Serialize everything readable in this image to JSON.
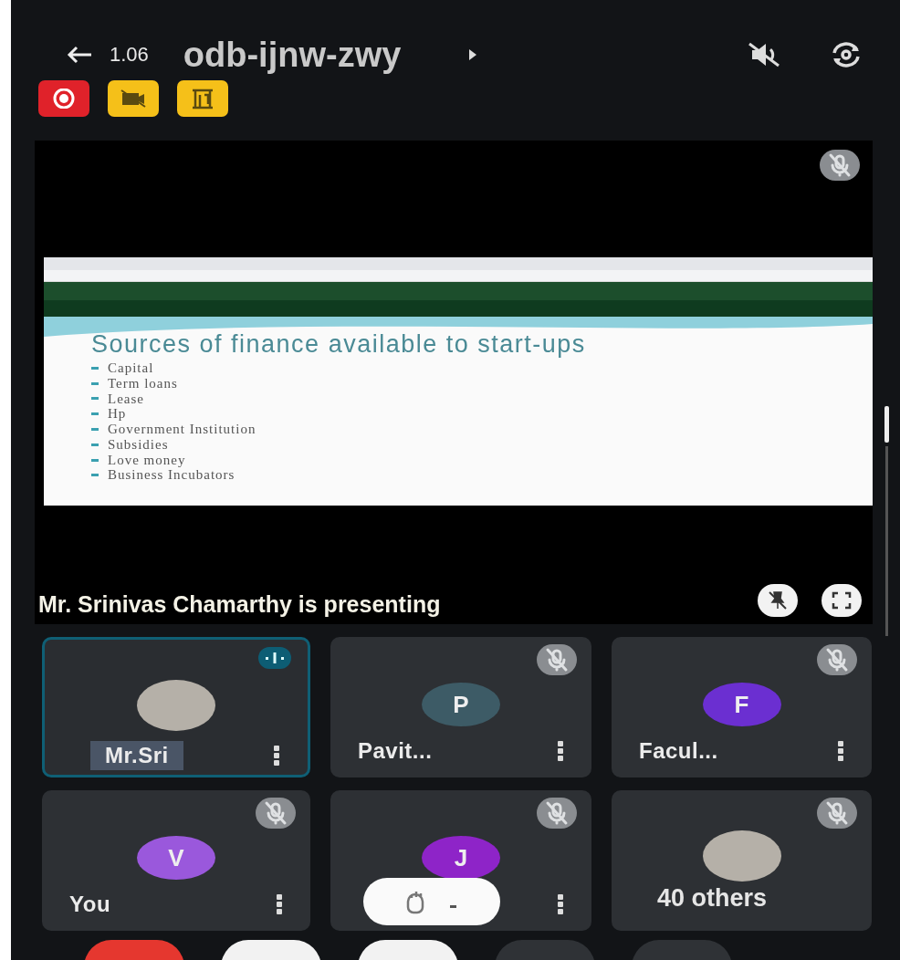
{
  "top_bar": {
    "speed": "1.06",
    "meeting_code": "odb-ijnw-zwy"
  },
  "status_chips": [
    {
      "kind": "record",
      "color": "#e0222a"
    },
    {
      "kind": "camera-off",
      "color": "#f5c019"
    },
    {
      "kind": "building",
      "color": "#f5c019"
    }
  ],
  "presentation": {
    "slide": {
      "title": "Sources of finance available to start-ups",
      "bullets": [
        "Capital",
        "Term loans",
        "Lease",
        "Hp",
        "Government Institution",
        "Subsidies",
        "Love money",
        "Business Incubators"
      ]
    },
    "banner": "Mr. Srinivas Chamarthy is presenting",
    "muted": true
  },
  "tiles": [
    {
      "kind": "photo",
      "name": "Mr.Sri",
      "speaking": true
    },
    {
      "kind": "initial",
      "initial": "P",
      "color": "#3d5b66",
      "name": "Pavit...",
      "speaking": false,
      "muted": true
    },
    {
      "kind": "initial",
      "initial": "F",
      "color": "#6b2fd1",
      "name": "Facul...",
      "speaking": false,
      "muted": true
    },
    {
      "kind": "initial",
      "initial": "V",
      "color": "#9a58dc",
      "name": "You",
      "speaking": false,
      "muted": true
    },
    {
      "kind": "initial",
      "initial": "J",
      "color": "#8e24c8",
      "speaking": false,
      "muted": true,
      "reaction": true
    },
    {
      "kind": "others",
      "name": "40 others",
      "speaking": false,
      "muted": true
    }
  ],
  "call_controls": [
    {
      "kind": "hangup"
    },
    {
      "kind": "light"
    },
    {
      "kind": "light"
    },
    {
      "kind": "dark"
    },
    {
      "kind": "dark"
    }
  ]
}
